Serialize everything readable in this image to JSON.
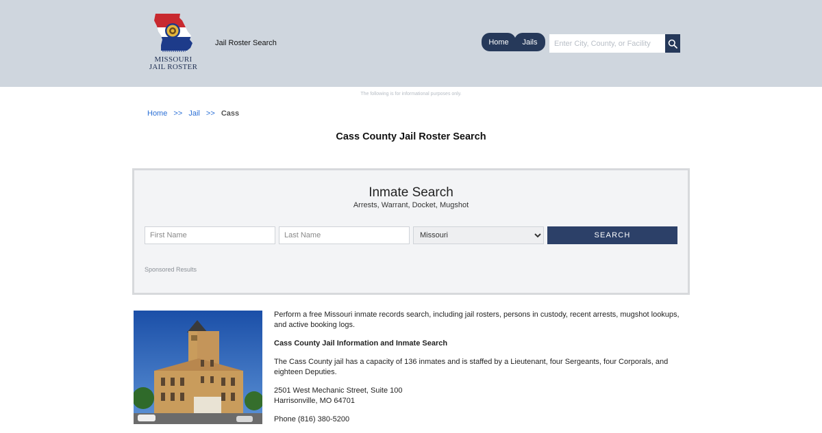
{
  "header": {
    "logo_line1": "MISSOURI",
    "logo_line2": "JAIL ROSTER",
    "site_title": "Jail Roster Search",
    "nav": {
      "home": "Home",
      "jails": "Jails"
    },
    "search": {
      "placeholder": "Enter City, County, or Facility"
    }
  },
  "disclaimer": "The following is for informational purposes only.",
  "breadcrumb": {
    "home": "Home",
    "sep1": ">>",
    "jail": "Jail",
    "sep2": ">>",
    "current": "Cass"
  },
  "page_title": "Cass County Jail Roster Search",
  "inmate_search": {
    "title": "Inmate Search",
    "subtitle": "Arrests, Warrant, Docket, Mugshot",
    "first_name_placeholder": "First Name",
    "last_name_placeholder": "Last Name",
    "state_selected": "Missouri",
    "search_label": "SEARCH",
    "sponsored": "Sponsored Results"
  },
  "content": {
    "intro": "Perform a free Missouri inmate records search, including jail rosters, persons in custody, recent arrests, mugshot lookups, and active booking logs.",
    "heading": "Cass County Jail Information and Inmate Search",
    "capacity": "The Cass County jail has a capacity of 136 inmates and is staffed by a Lieutenant, four Sergeants, four Corporals, and eighteen Deputies.",
    "address_line1": "2501 West Mechanic Street, Suite 100",
    "address_line2": "Harrisonville, MO 64701",
    "phone": "Phone (816) 380-5200"
  },
  "colors": {
    "header_bg": "#cfd6de",
    "nav_bg": "#26395a",
    "search_button": "#2c4068",
    "link": "#2a6fd6"
  }
}
